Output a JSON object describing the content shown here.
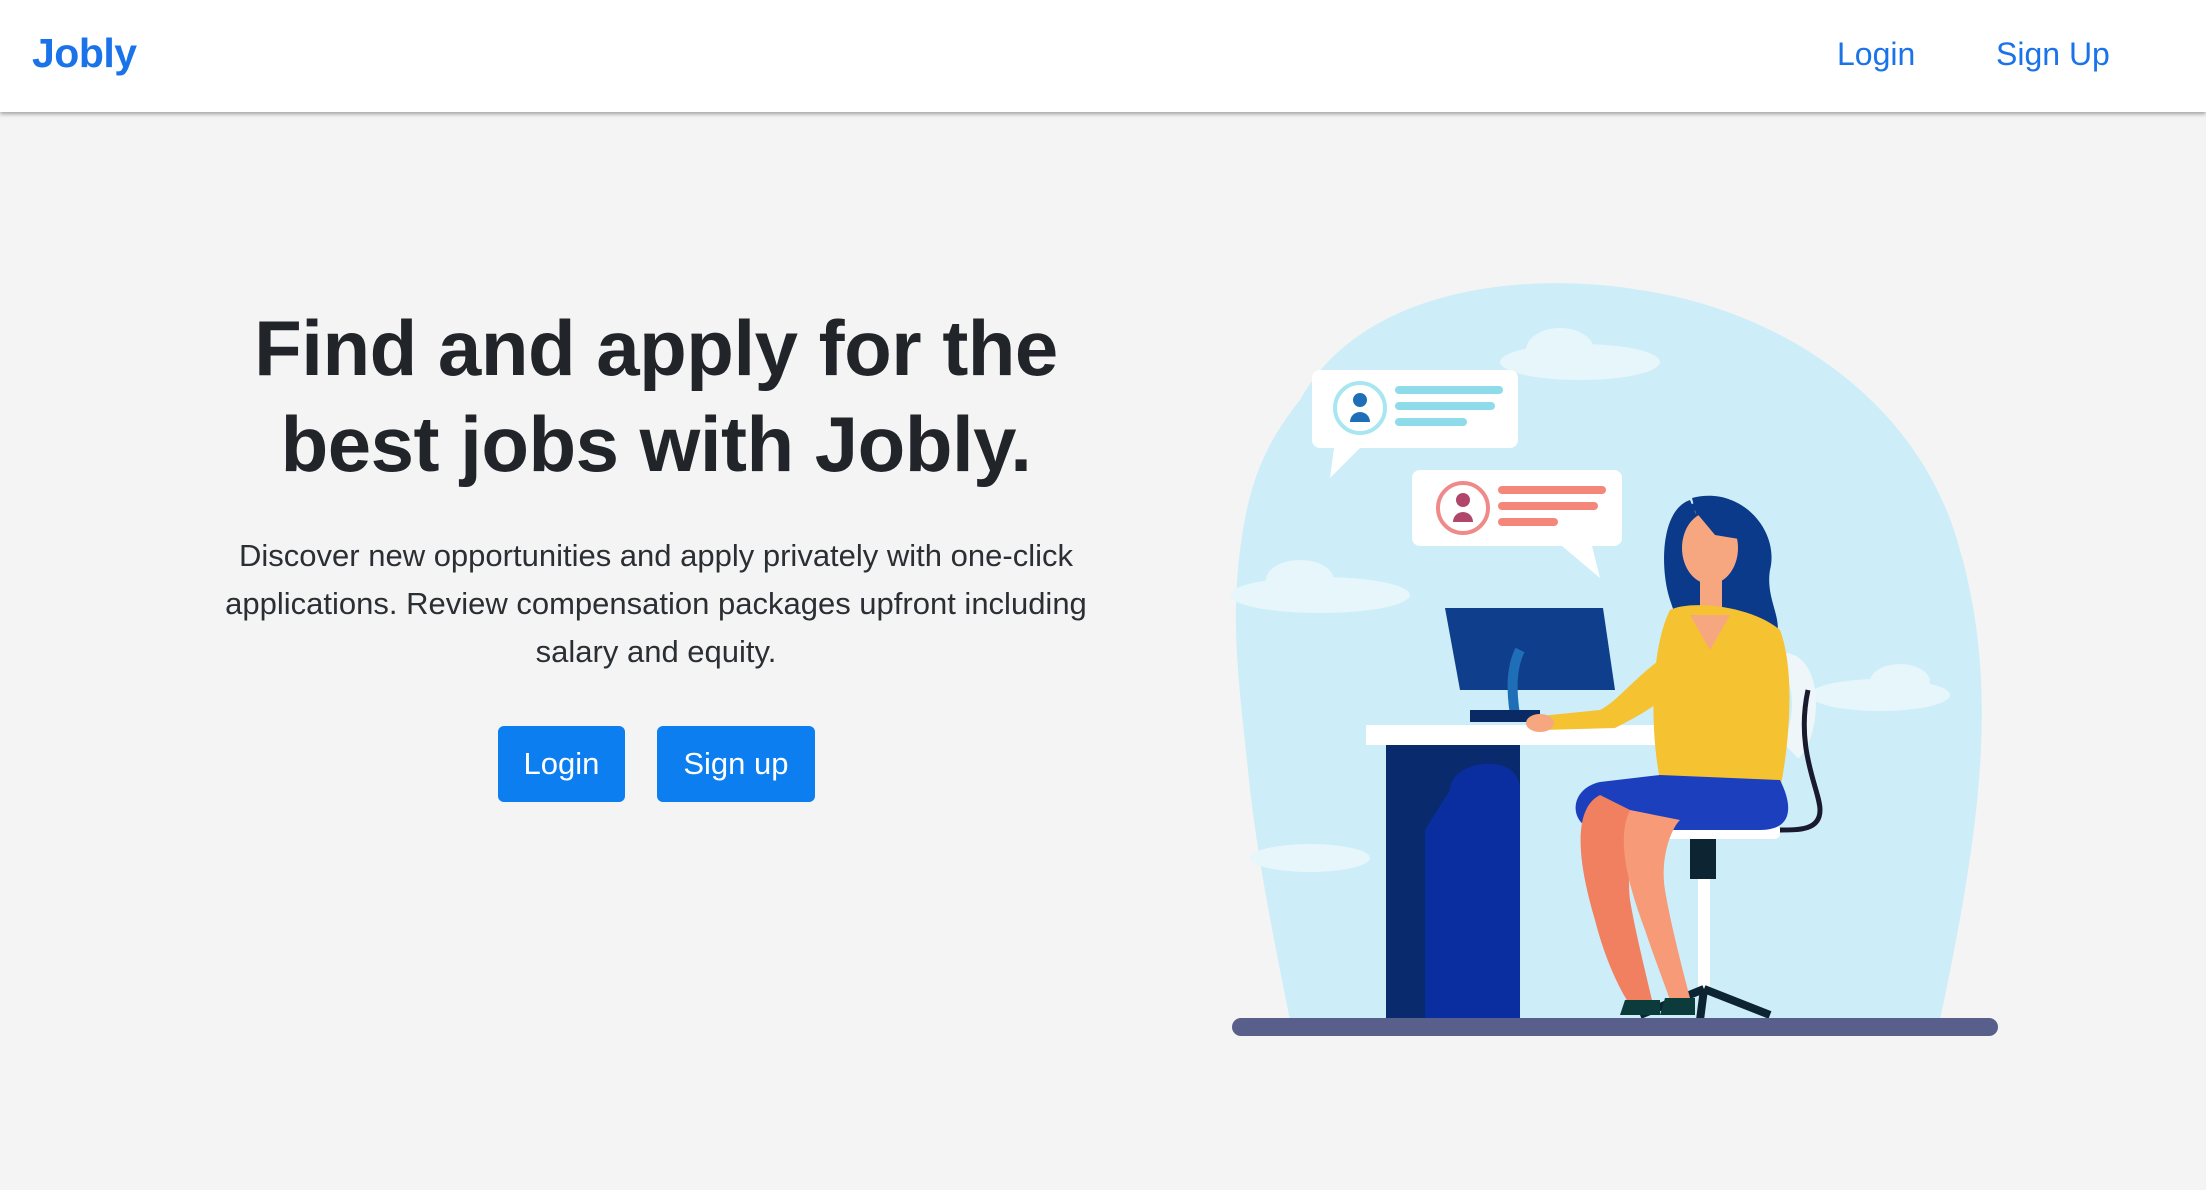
{
  "navbar": {
    "brand": "Jobly",
    "login_label": "Login",
    "signup_label": "Sign Up"
  },
  "hero": {
    "headline_line1": "Find and apply for the",
    "headline_line2": "best jobs with Jobly.",
    "description": "Discover new opportunities and apply privately with one-click applications. Review compensation packages upfront including salary and equity.",
    "login_button": "Login",
    "signup_button": "Sign up"
  },
  "colors": {
    "accent": "#1a73e8",
    "button": "#0d7ef0",
    "background": "#f4f4f4"
  }
}
